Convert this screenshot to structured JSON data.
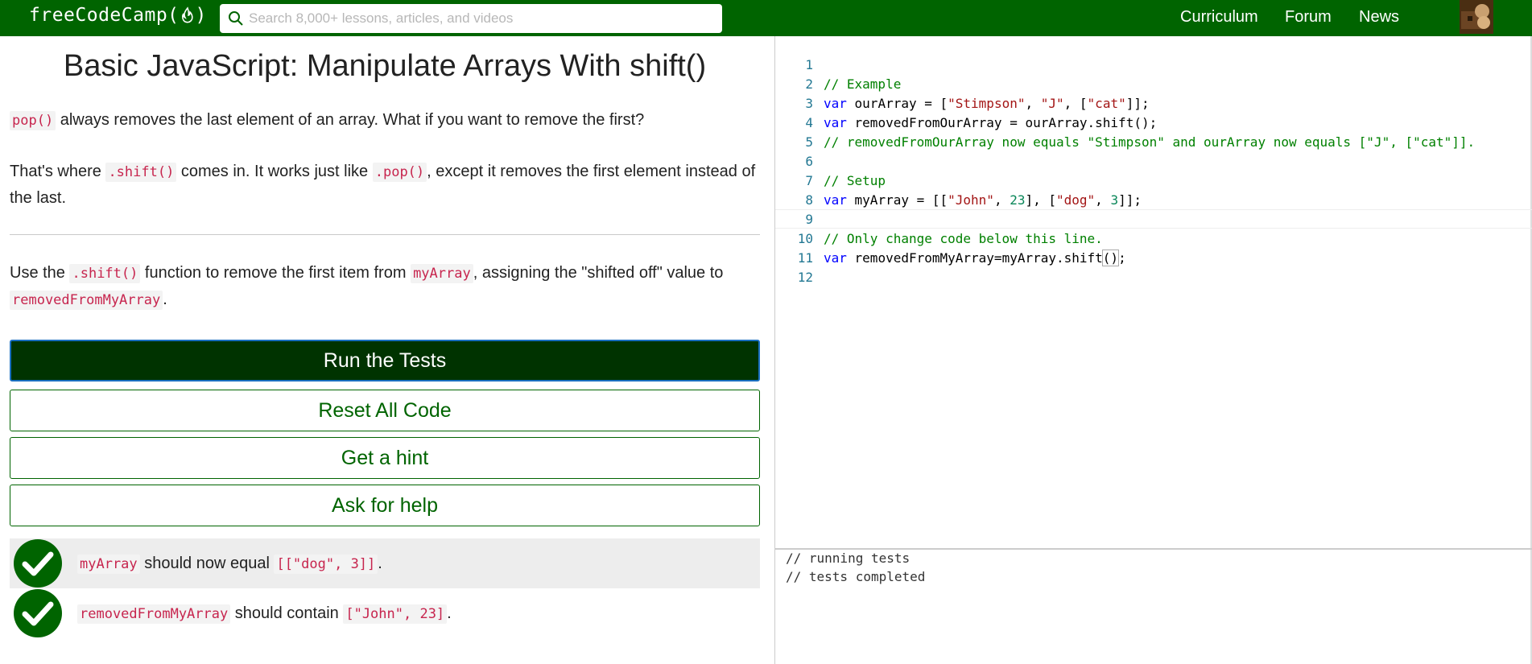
{
  "navbar": {
    "logo_text_left": "freeCodeCamp(",
    "logo_text_right": ")",
    "search_placeholder": "Search 8,000+ lessons, articles, and videos",
    "links": [
      "Curriculum",
      "Forum",
      "News"
    ]
  },
  "challenge": {
    "title": "Basic JavaScript: Manipulate Arrays With shift()",
    "p1": {
      "code": "pop()",
      "text": " always removes the last element of an array. What if you want to remove the first?"
    },
    "p2": {
      "t1": "That's where ",
      "c1": ".shift()",
      "t2": " comes in. It works just like ",
      "c2": ".pop()",
      "t3": ", except it removes the first element instead of the last."
    },
    "p3": {
      "t1": "Use the ",
      "c1": ".shift()",
      "t2": " function to remove the first item from ",
      "c2": "myArray",
      "t3": ", assigning the \"shifted off\" value to ",
      "c3": "removedFromMyArray",
      "t4": "."
    }
  },
  "buttons": {
    "run": "Run the Tests",
    "reset": "Reset All Code",
    "hint": "Get a hint",
    "help": "Ask for help"
  },
  "tests": [
    {
      "code1": "myArray",
      "text": " should now equal ",
      "code2": "[[\"dog\", 3]]",
      "end": "."
    },
    {
      "code1": "removedFromMyArray",
      "text": " should contain ",
      "code2": "[\"John\", 23]",
      "end": "."
    }
  ],
  "editor": {
    "line_numbers": [
      "1",
      "2",
      "3",
      "4",
      "5",
      "6",
      "7",
      "8",
      "9",
      "10",
      "11",
      "12"
    ],
    "l1": "// Example",
    "l2": {
      "k": "var",
      "a": " ourArray = [",
      "s1": "\"Stimpson\"",
      "b": ", ",
      "s2": "\"J\"",
      "c": ", [",
      "s3": "\"cat\"",
      "d": "]];"
    },
    "l3": {
      "k": "var",
      "a": " removedFromOurArray = ourArray.shift();"
    },
    "l4": "// removedFromOurArray now equals \"Stimpson\" and ourArray now equals [\"J\", [\"cat\"]].",
    "l6": "// Setup",
    "l7": {
      "k": "var",
      "a": " myArray = [[",
      "s1": "\"John\"",
      "b": ", ",
      "n1": "23",
      "c": "], [",
      "s2": "\"dog\"",
      "d": ", ",
      "n2": "3",
      "e": "]];"
    },
    "l9": "// Only change code below this line.",
    "l10": {
      "k": "var",
      "a": " removedFromMyArray=myArray.shift",
      "p": "()",
      "b": ";"
    }
  },
  "console": {
    "lines": [
      "// running tests",
      "// tests completed"
    ]
  },
  "colors": {
    "navbar": "#006400",
    "primary_button": "#003300",
    "accent_green": "#006400",
    "code_red": "#c7254e"
  }
}
